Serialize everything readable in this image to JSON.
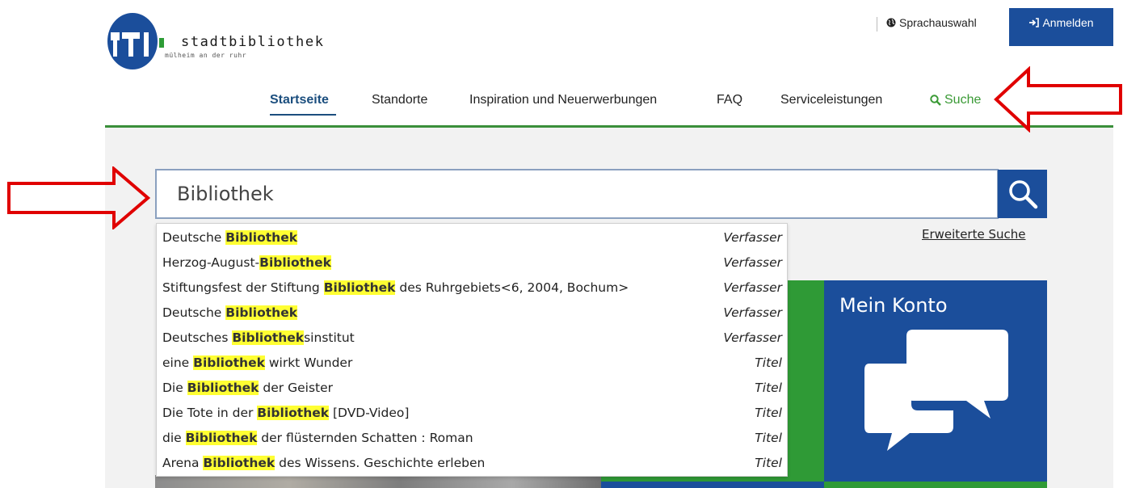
{
  "header": {
    "logo_name": "stadtbibliothek",
    "logo_sub": "mülheim an der ruhr",
    "language_label": "Sprachauswahl",
    "login_label": "Anmelden"
  },
  "nav": {
    "items": [
      "Startseite",
      "Standorte",
      "Inspiration und Neuerwerbungen",
      "FAQ",
      "Serviceleistungen"
    ],
    "search_label": "Suche"
  },
  "search": {
    "value": "Bibliothek",
    "advanced_label": "Erweiterte Suche"
  },
  "suggestions": [
    {
      "before": "Deutsche ",
      "match": "Bibliothek",
      "after": "",
      "type": "Verfasser"
    },
    {
      "before": "Herzog-August-",
      "match": "Bibliothek",
      "after": "",
      "type": "Verfasser"
    },
    {
      "before": "Stiftungsfest der Stiftung ",
      "match": "Bibliothek",
      "after": " des Ruhrgebiets<6, 2004, Bochum>",
      "type": "Verfasser"
    },
    {
      "before": "Deutsche ",
      "match": "Bibliothek",
      "after": "",
      "type": "Verfasser"
    },
    {
      "before": "Deutsches ",
      "match": "Bibliothek",
      "after": "sinstitut",
      "type": "Verfasser"
    },
    {
      "before": "eine ",
      "match": "Bibliothek",
      "after": " wirkt Wunder",
      "type": "Titel"
    },
    {
      "before": "Die ",
      "match": "Bibliothek",
      "after": " der Geister",
      "type": "Titel"
    },
    {
      "before": "Die Tote in der ",
      "match": "Bibliothek",
      "after": " [DVD-Video]",
      "type": "Titel"
    },
    {
      "before": "die ",
      "match": "Bibliothek",
      "after": " der flüsternden Schatten : Roman",
      "type": "Titel"
    },
    {
      "before": "Arena ",
      "match": "Bibliothek",
      "after": " des Wissens. Geschichte erleben",
      "type": "Titel"
    }
  ],
  "tiles": {
    "konto_title": "Mein Konto"
  },
  "colors": {
    "brand_blue": "#1b4e9b",
    "brand_green": "#2f9a36",
    "highlight": "#ffff33",
    "annotation_red": "#e00000"
  },
  "icons": [
    "globe-icon",
    "login-icon",
    "search-icon",
    "chat-bubbles-icon",
    "arrow-annotation"
  ]
}
